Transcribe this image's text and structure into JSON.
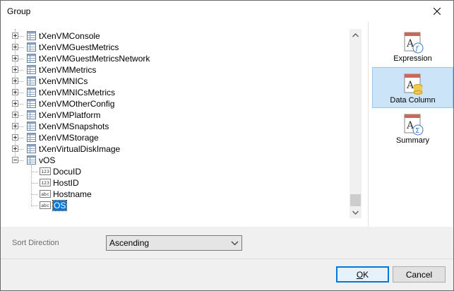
{
  "window": {
    "title": "Group",
    "close_icon": "close-icon"
  },
  "tree": {
    "tables": [
      "tXenVMConsole",
      "tXenVMGuestMetrics",
      "tXenVMGuestMetricsNetwork",
      "tXenVMMetrics",
      "tXenVMNICs",
      "tXenVMNICsMetrics",
      "tXenVMOtherConfig",
      "tXenVMPlatform",
      "tXenVMSnapshots",
      "tXenVMStorage",
      "tXenVirtualDiskImage"
    ],
    "expanded_table": "vOS",
    "fields": [
      {
        "label": "DocuID",
        "type_icon": "123",
        "selected": false
      },
      {
        "label": "HostID",
        "type_icon": "123",
        "selected": false
      },
      {
        "label": "Hostname",
        "type_icon": "abc",
        "selected": false
      },
      {
        "label": "OS",
        "type_icon": "abc",
        "selected": true
      }
    ]
  },
  "side_buttons": [
    {
      "label": "Expression",
      "icon": "expression-icon",
      "active": false
    },
    {
      "label": "Data Column",
      "icon": "data-column-icon",
      "active": true
    },
    {
      "label": "Summary",
      "icon": "summary-icon",
      "active": false
    }
  ],
  "sort": {
    "label": "Sort Direction",
    "value": "Ascending"
  },
  "buttons": {
    "ok_label": "OK",
    "cancel_label": "Cancel"
  },
  "colors": {
    "selection": "#0078d7",
    "active_side_bg": "#cce4f7"
  }
}
